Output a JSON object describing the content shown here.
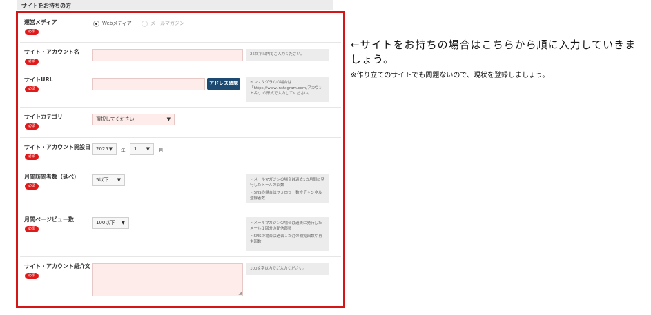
{
  "section_title": "サイトをお持ちの方",
  "required_badge": "必須",
  "media": {
    "label": "運営メディア",
    "options": [
      "Webメディア",
      "メールマガジン"
    ],
    "selected": "Webメディア"
  },
  "account_name": {
    "label": "サイト・アカウント名",
    "hint": "25文字以内でご入力ください。"
  },
  "site_url": {
    "label": "サイトURL",
    "button": "アドレス確認",
    "hint": "インスタグラムの場合は「https://www.instagram.com/アカウント名/」の形式で入力してください。"
  },
  "category": {
    "label": "サイトカテゴリ",
    "selected": "選択してください"
  },
  "open_date": {
    "label": "サイト・アカウント開設日",
    "year": "2025",
    "year_unit": "年",
    "month": "1",
    "month_unit": "月"
  },
  "visitors": {
    "label": "月間訪問者数（延べ）",
    "selected": "5以下",
    "hints": [
      "メールマガジンの場合は過去1カ月間に発行したメールの回数",
      "SNSの場合はフォロワー数やチャンネル登録者数"
    ]
  },
  "pageviews": {
    "label": "月間ページビュー数",
    "selected": "100以下",
    "hints": [
      "メールマガジンの場合は過去に発行したメール１回分の配信部数",
      "SNSの場合は過去１か月の閲覧回数や再生回数"
    ]
  },
  "intro": {
    "label": "サイト・アカウント紹介文",
    "hint": "100文字以内でご入力ください。"
  },
  "annotation": {
    "main": "←サイトをお持ちの場合はこちらから順に入力していきましょう。",
    "sub": "※作り立てのサイトでも問題ないので、現状を登録しましょう。"
  },
  "colors": {
    "frame": "#d51616",
    "required": "#e01a1a",
    "button": "#1d4a70",
    "input_bg": "#fdecea"
  }
}
